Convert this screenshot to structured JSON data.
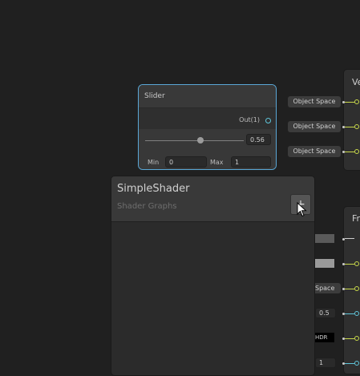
{
  "slider_node": {
    "title": "Slider",
    "output_label": "Out(1)",
    "value": "0.56",
    "min_label": "Min",
    "min_value": "0",
    "max_label": "Max",
    "max_value": "1",
    "slider_fraction": 0.56
  },
  "blackboard": {
    "title": "SimpleShader",
    "subtitle": "Shader Graphs",
    "add_button_label": "+"
  },
  "vertex_inputs": [
    {
      "label": "Object Space"
    },
    {
      "label": "Object Space"
    },
    {
      "label": "Object Space"
    }
  ],
  "fragment_inputs": {
    "space_label": "Space",
    "float_value": "0.5",
    "hdr_label": "HDR",
    "int_value": "1"
  },
  "master_nodes": {
    "vertex_title": "Ve",
    "fragment_title": "Fr"
  },
  "colors": {
    "selection_border": "#5aa7d6",
    "vector_port": "#c8d84a",
    "float_port": "#5fc4d9",
    "background": "#202020"
  }
}
